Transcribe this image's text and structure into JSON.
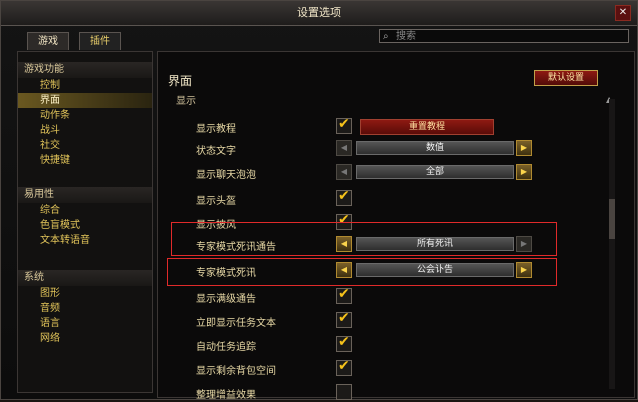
{
  "window": {
    "title": "设置选项"
  },
  "tabs": [
    {
      "label": "游戏"
    },
    {
      "label": "插件"
    }
  ],
  "search": {
    "placeholder": "搜索"
  },
  "sidebar": {
    "groups": [
      {
        "header": "游戏功能",
        "items": [
          "控制",
          "界面",
          "动作条",
          "战斗",
          "社交",
          "快捷键"
        ]
      },
      {
        "header": "易用性",
        "items": [
          "综合",
          "色盲模式",
          "文本转语音"
        ]
      },
      {
        "header": "系统",
        "items": [
          "图形",
          "音频",
          "语言",
          "网络"
        ]
      }
    ],
    "active_item": "界面"
  },
  "main": {
    "title": "界面",
    "section": "显示",
    "defaults_button": "默认设置",
    "rows": [
      {
        "label": "显示教程",
        "type": "checkbox-button",
        "checked": true,
        "button": "重置教程"
      },
      {
        "label": "状态文字",
        "type": "stepper",
        "value": "数值"
      },
      {
        "label": "显示聊天泡泡",
        "type": "stepper",
        "value": "全部"
      },
      {
        "label": "显示头盔",
        "type": "checkbox",
        "checked": true
      },
      {
        "label": "显示披风",
        "type": "checkbox",
        "checked": true
      },
      {
        "label": "专家模式死讯通告",
        "type": "stepper",
        "value": "所有死讯"
      },
      {
        "label": "专家模式死讯",
        "type": "stepper",
        "value": "公会讣告"
      },
      {
        "label": "显示满级通告",
        "type": "checkbox",
        "checked": true
      },
      {
        "label": "立即显示任务文本",
        "type": "checkbox",
        "checked": true
      },
      {
        "label": "自动任务追踪",
        "type": "checkbox",
        "checked": true
      },
      {
        "label": "显示剩余背包空间",
        "type": "checkbox",
        "checked": true
      },
      {
        "label": "整理增益效果",
        "type": "checkbox",
        "checked": false
      }
    ]
  },
  "colors": {
    "accent": "#f5c21b",
    "highlight_box": "#e02a2a",
    "danger": "#8e1a12"
  }
}
